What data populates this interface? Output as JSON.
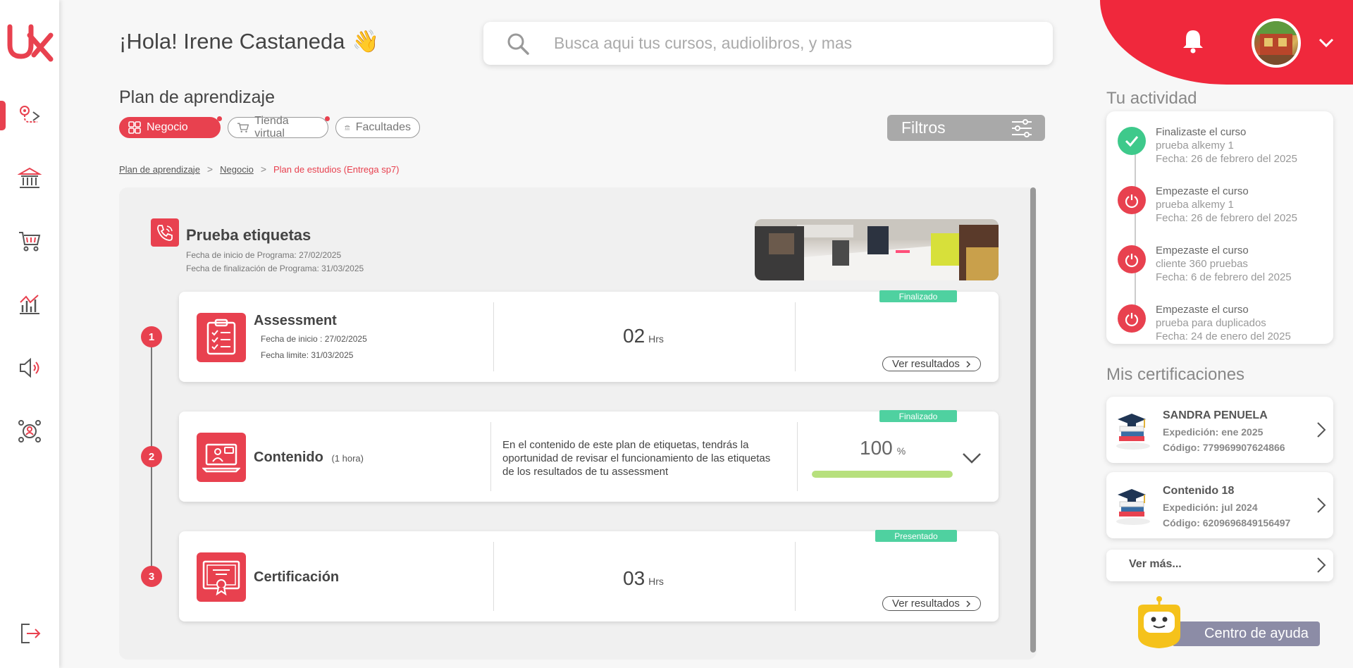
{
  "brand": {
    "logo_text": "UX",
    "accent": "#e8414f",
    "header_red": "#f0283c"
  },
  "header": {
    "greeting": "¡Hola! Irene Castaneda",
    "wave_emoji": "👋",
    "search_placeholder": "Busca aqui tus cursos, audiolibros, y mas"
  },
  "sidebar": {
    "items": [
      {
        "name": "learning-path",
        "icon": "route-icon",
        "active": true
      },
      {
        "name": "institution",
        "icon": "bank-icon",
        "active": false
      },
      {
        "name": "store",
        "icon": "cart-icon",
        "active": false
      },
      {
        "name": "stats",
        "icon": "chart-icon",
        "active": false
      },
      {
        "name": "audio",
        "icon": "speaker-icon",
        "active": false
      },
      {
        "name": "network",
        "icon": "network-icon",
        "active": false
      }
    ],
    "logout_icon": "logout-icon"
  },
  "plan": {
    "title": "Plan de aprendizaje",
    "chips": [
      {
        "label": "Negocio",
        "active": true,
        "dot": true
      },
      {
        "label": "Tienda virtual",
        "active": false,
        "dot": true
      },
      {
        "label": "Facultades",
        "active": false,
        "dot": false
      }
    ],
    "filters_label": "Filtros",
    "breadcrumb": [
      "Plan de aprendizaje",
      "Negocio",
      "Plan de estudios (Entrega sp7)"
    ]
  },
  "program": {
    "title": "Prueba etiquetas",
    "start_date": "Fecha de inicio de Programa: 27/02/2025",
    "end_date": "Fecha de finalización de Programa: 31/03/2025",
    "steps": [
      {
        "num": "1",
        "title": "Assessment",
        "start": "Fecha de inicio : 27/02/2025",
        "limit": "Fecha limite: 31/03/2025",
        "hours": "02",
        "hours_unit": "Hrs",
        "badge": "Finalizado",
        "button": "Ver resultados"
      },
      {
        "num": "2",
        "title": "Contenido",
        "duration": "(1 hora)",
        "description": "En el contenido de este plan de etiquetas, tendrás la oportunidad de revisar el funcionamiento de las etiquetas de los resultados de tu assessment",
        "percent": "100",
        "percent_unit": "%",
        "progress": 1.0,
        "badge": "Finalizado"
      },
      {
        "num": "3",
        "title": "Certificación",
        "hours": "03",
        "hours_unit": "Hrs",
        "badge": "Presentado",
        "button": "Ver resultados"
      }
    ]
  },
  "activity": {
    "title": "Tu actividad",
    "items": [
      {
        "status": "done",
        "action": "Finalizaste el curso",
        "course": "prueba alkemy 1",
        "date": "Fecha: 26 de febrero del 2025"
      },
      {
        "status": "start",
        "action": "Empezaste el curso",
        "course": "prueba alkemy 1",
        "date": "Fecha: 26 de febrero del 2025"
      },
      {
        "status": "start",
        "action": "Empezaste el curso",
        "course": "cliente 360 pruebas",
        "date": "Fecha: 6 de febrero del 2025"
      },
      {
        "status": "start",
        "action": "Empezaste el curso",
        "course": "prueba para duplicados",
        "date": "Fecha: 24 de enero del 2025"
      }
    ]
  },
  "certifications": {
    "title": "Mis certificaciones",
    "items": [
      {
        "name": "SANDRA PENUELA",
        "issued": "Expedición: ene 2025",
        "code": "Código: 779969907624866"
      },
      {
        "name": "Contenido 18",
        "issued": "Expedición: jul 2024",
        "code": "Código: 6209696849156497"
      }
    ],
    "more_label": "Ver más..."
  },
  "help": {
    "label": "Centro de ayuda"
  }
}
